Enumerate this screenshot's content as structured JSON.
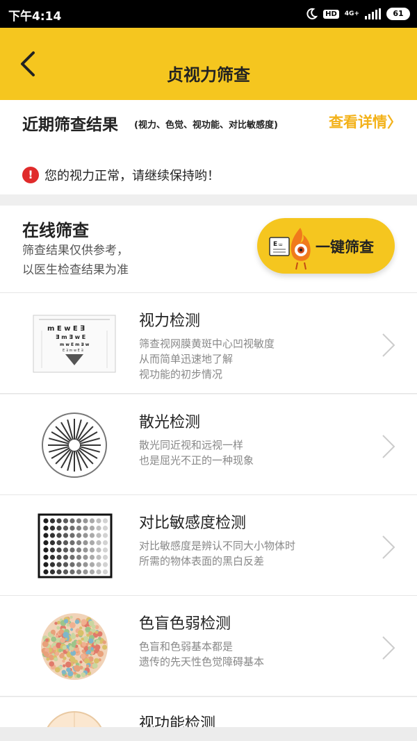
{
  "status_bar": {
    "time": "下午4:14",
    "hd": "HD",
    "network": "4G+",
    "battery": "61"
  },
  "app_bar": {
    "title": "贞视力筛查",
    "back_icon": "chevron-left-icon"
  },
  "recent": {
    "title": "近期筛查结果",
    "subtitle": "(视力、色觉、视功能、对比敏感度)",
    "details_link": "查看详情〉",
    "alert_icon": "!",
    "alert_text": "您的视力正常，请继续保持哟！"
  },
  "online": {
    "title": "在线筛查",
    "note_line1": "筛查结果仅供参考，",
    "note_line2": "以医生检查结果为准",
    "one_click_label": "一键筛查"
  },
  "tests": [
    {
      "name": "视力检测",
      "desc1": "筛查视网膜黄斑中心凹视敏度",
      "desc2": "从而简单迅速地了解",
      "desc3": "视功能的初步情况"
    },
    {
      "name": "散光检测",
      "desc1": "散光同近视和远视一样",
      "desc2": "也是屈光不正的一种现象",
      "desc3": ""
    },
    {
      "name": "对比敏感度检测",
      "desc1": "对比敏感度是辨认不同大小物体时",
      "desc2": "所需的物体表面的黑白反差",
      "desc3": ""
    },
    {
      "name": "色盲色弱检测",
      "desc1": "色盲和色弱基本都是",
      "desc2": "遗传的先天性色觉障碍基本",
      "desc3": ""
    },
    {
      "name": "视功能检测",
      "desc1": "",
      "desc2": "",
      "desc3": ""
    }
  ],
  "colors": {
    "accent": "#f5c61f",
    "link": "#f3b21a",
    "alert": "#e02b2b"
  }
}
